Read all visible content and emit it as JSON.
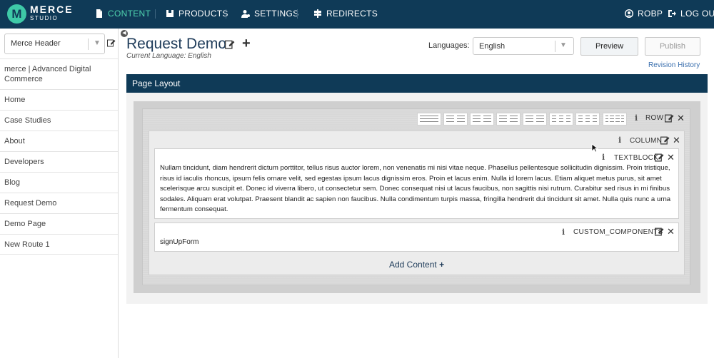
{
  "nav": {
    "logo_letter": "M",
    "brand_line1": "MERCE",
    "brand_line2": "STUDIO",
    "items": [
      {
        "label": "CONTENT",
        "icon": "document-icon",
        "active": true
      },
      {
        "label": "PRODUCTS",
        "icon": "box-icon",
        "active": false
      },
      {
        "label": "SETTINGS",
        "icon": "user-gear-icon",
        "active": false
      },
      {
        "label": "REDIRECTS",
        "icon": "signpost-icon",
        "active": false
      }
    ],
    "user": "ROBP",
    "logout": "LOG OUT",
    "colors": {
      "bar": "#0f3a57",
      "active": "#4fd2ae",
      "logo": "#3ec9a7"
    }
  },
  "sidebar": {
    "header_select": "Merce Header",
    "items": [
      "merce | Advanced Digital Commerce",
      "Home",
      "Case Studies",
      "About",
      "Developers",
      "Blog",
      "Request Demo",
      "Demo Page",
      "New Route 1"
    ]
  },
  "page": {
    "title": "Request Demo",
    "current_language": "Current Language: English",
    "languages_label": "Languages:",
    "language_value": "English",
    "preview": "Preview",
    "publish": "Publish",
    "revision_history": "Revision History"
  },
  "layout": {
    "title": "Page Layout",
    "row_label": "ROW",
    "column_label": "COLUMN",
    "textblock_label": "TEXTBLOCK",
    "textblock_text": "Nullam tincidunt, diam hendrerit dictum porttitor, tellus risus auctor lorem, non venenatis mi nisi vitae neque. Phasellus pellentesque sollicitudin dignissim. Proin tristique, risus id iaculis rhoncus, ipsum felis ornare velit, sed egestas ipsum lacus dignissim eros. Proin et lacus enim. Nulla id lorem lacus. Etiam aliquet metus purus, sit amet scelerisque arcu suscipit et. Donec id viverra libero, ut consectetur sem. Donec consequat nisi ut lacus faucibus, non sagittis nisi rutrum. Curabitur sed risus in mi finibus sodales. Aliquam erat volutpat. Praesent blandit ac sapien non faucibus. Nulla condimentum turpis massa, fringilla hendrerit dui tincidunt sit amet. Nulla quis nunc a urna fermentum consequat.",
    "custom_label": "CUSTOM_COMPONENTS",
    "custom_value": "signUpForm",
    "add_content": "Add Content",
    "info_glyph": "i",
    "close_glyph": "✕",
    "plus_glyph": "+",
    "collapse_glyph": "◀"
  }
}
